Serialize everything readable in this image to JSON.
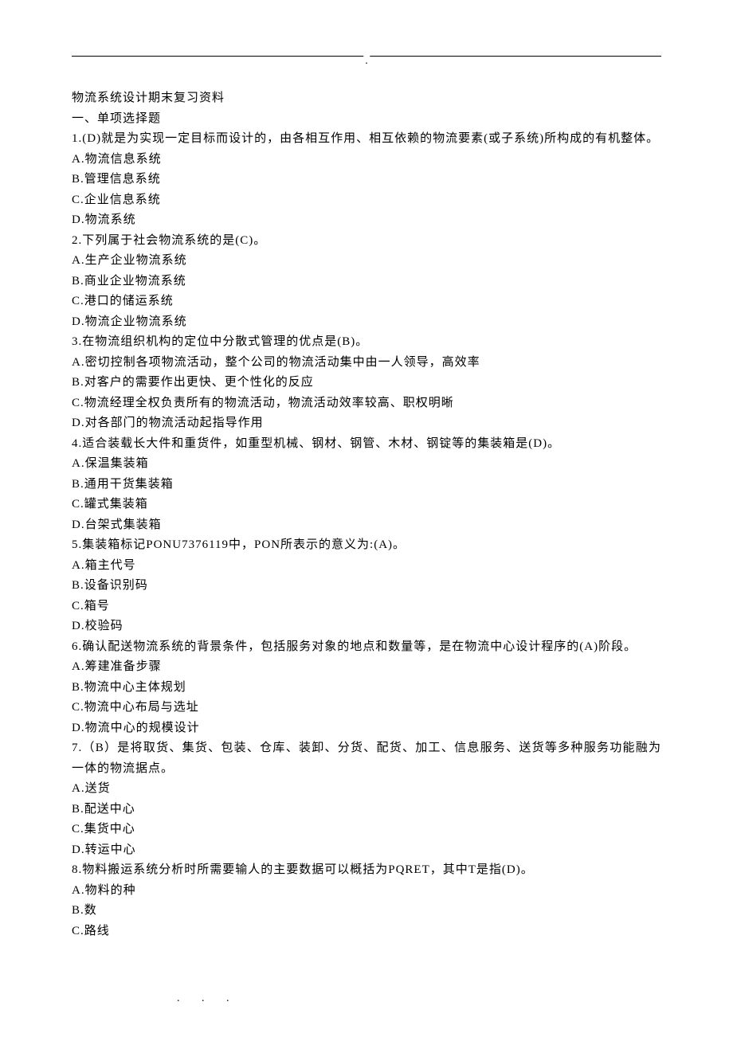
{
  "header_mark": ".",
  "title": "物流系统设计期末复习资料",
  "section_heading": "一、单项选择题",
  "questions": [
    {
      "stem": "1.(D)就是为实现一定目标而设计的，由各相互作用、相互依赖的物流要素(或子系统)所构成的有机整体。",
      "options": [
        "A.物流信息系统",
        "B.管理信息系统",
        "C.企业信息系统",
        "D.物流系统"
      ]
    },
    {
      "stem": "2.下列属于社会物流系统的是(C)。",
      "options": [
        "A.生产企业物流系统",
        "B.商业企业物流系统",
        "C.港口的储运系统",
        "D.物流企业物流系统"
      ]
    },
    {
      "stem": "3.在物流组织机构的定位中分散式管理的优点是(B)。",
      "options": [
        "A.密切控制各项物流活动，整个公司的物流活动集中由一人领导，高效率",
        "B.对客户的需要作出更快、更个性化的反应",
        "C.物流经理全权负责所有的物流活动，物流活动效率较高、职权明晰",
        "D.对各部门的物流活动起指导作用"
      ]
    },
    {
      "stem": "4.适合装载长大件和重货件，如重型机械、钢材、钢管、木材、钢锭等的集装箱是(D)。",
      "options": [
        "A.保温集装箱",
        "B.通用干货集装箱",
        "C.罐式集装箱",
        "D.台架式集装箱"
      ]
    },
    {
      "stem": "5.集装箱标记PONU7376119中，PON所表示的意义为:(A)。",
      "options": [
        "A.箱主代号",
        "B.设备识别码",
        "C.箱号",
        "D.校验码"
      ]
    },
    {
      "stem": "6.确认配送物流系统的背景条件，包括服务对象的地点和数量等，是在物流中心设计程序的(A)阶段。",
      "options": [
        "A.筹建准备步骤",
        "B.物流中心主体规划",
        "C.物流中心布局与选址",
        "D.物流中心的规模设计"
      ]
    },
    {
      "stem": "7.（B）是将取货、集货、包装、仓库、装卸、分货、配货、加工、信息服务、送货等多种服务功能融为一体的物流据点。",
      "options": [
        "A.送货",
        "B.配送中心",
        "C.集货中心",
        "D.转运中心"
      ]
    },
    {
      "stem": "8.物料搬运系统分析时所需要输人的主要数据可以概括为PQRET，其中T是指(D)。",
      "options": [
        "A.物料的种",
        "B.数",
        "C.路线"
      ]
    }
  ],
  "footer": ".   .   ."
}
